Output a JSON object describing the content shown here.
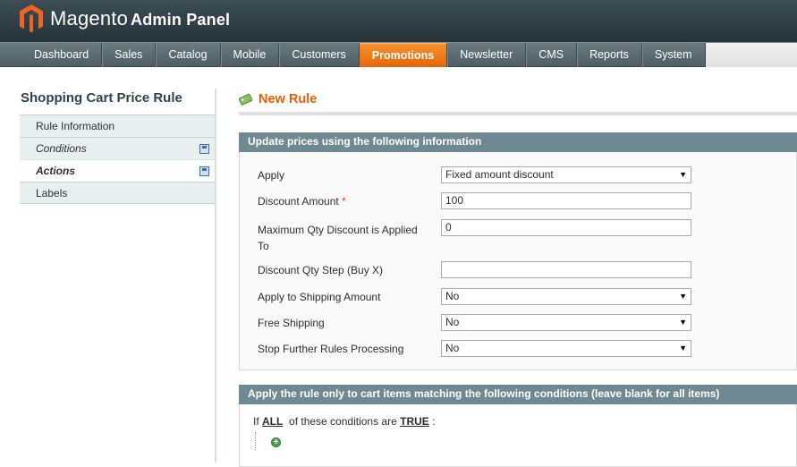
{
  "header": {
    "brand": "Magento",
    "brand_sub": "Admin Panel"
  },
  "nav": {
    "items": [
      "Dashboard",
      "Sales",
      "Catalog",
      "Mobile",
      "Customers",
      "Promotions",
      "Newsletter",
      "CMS",
      "Reports",
      "System"
    ],
    "active": "Promotions"
  },
  "sidebar": {
    "title": "Shopping Cart Price Rule",
    "tabs": [
      {
        "label": "Rule Information"
      },
      {
        "label": "Conditions"
      },
      {
        "label": "Actions"
      },
      {
        "label": "Labels"
      }
    ]
  },
  "page": {
    "title": "New Rule"
  },
  "actions_box": {
    "title": "Update prices using the following information",
    "fields": {
      "apply": {
        "label": "Apply",
        "value": "Fixed amount discount"
      },
      "discount_amount": {
        "label": "Discount Amount",
        "required_mark": "*",
        "value": "100"
      },
      "max_qty": {
        "label_line1": "Maximum Qty Discount is Applied",
        "label_line2": "To",
        "value": "0"
      },
      "qty_step": {
        "label": "Discount Qty Step (Buy X)",
        "value": ""
      },
      "apply_shipping": {
        "label": "Apply to Shipping Amount",
        "value": "No"
      },
      "free_shipping": {
        "label": "Free Shipping",
        "value": "No"
      },
      "stop_rules": {
        "label": "Stop Further Rules Processing",
        "value": "No"
      }
    }
  },
  "conditions_box": {
    "title": "Apply the rule only to cart items matching the following conditions (leave blank for all items)",
    "prefix": "If",
    "aggregator": "ALL",
    "middle": "of these conditions are",
    "value": "TRUE",
    "suffix": ":"
  },
  "colors": {
    "accent": "#eb5e00",
    "nav_active": "#f7932e",
    "box_header": "#6f8992"
  }
}
